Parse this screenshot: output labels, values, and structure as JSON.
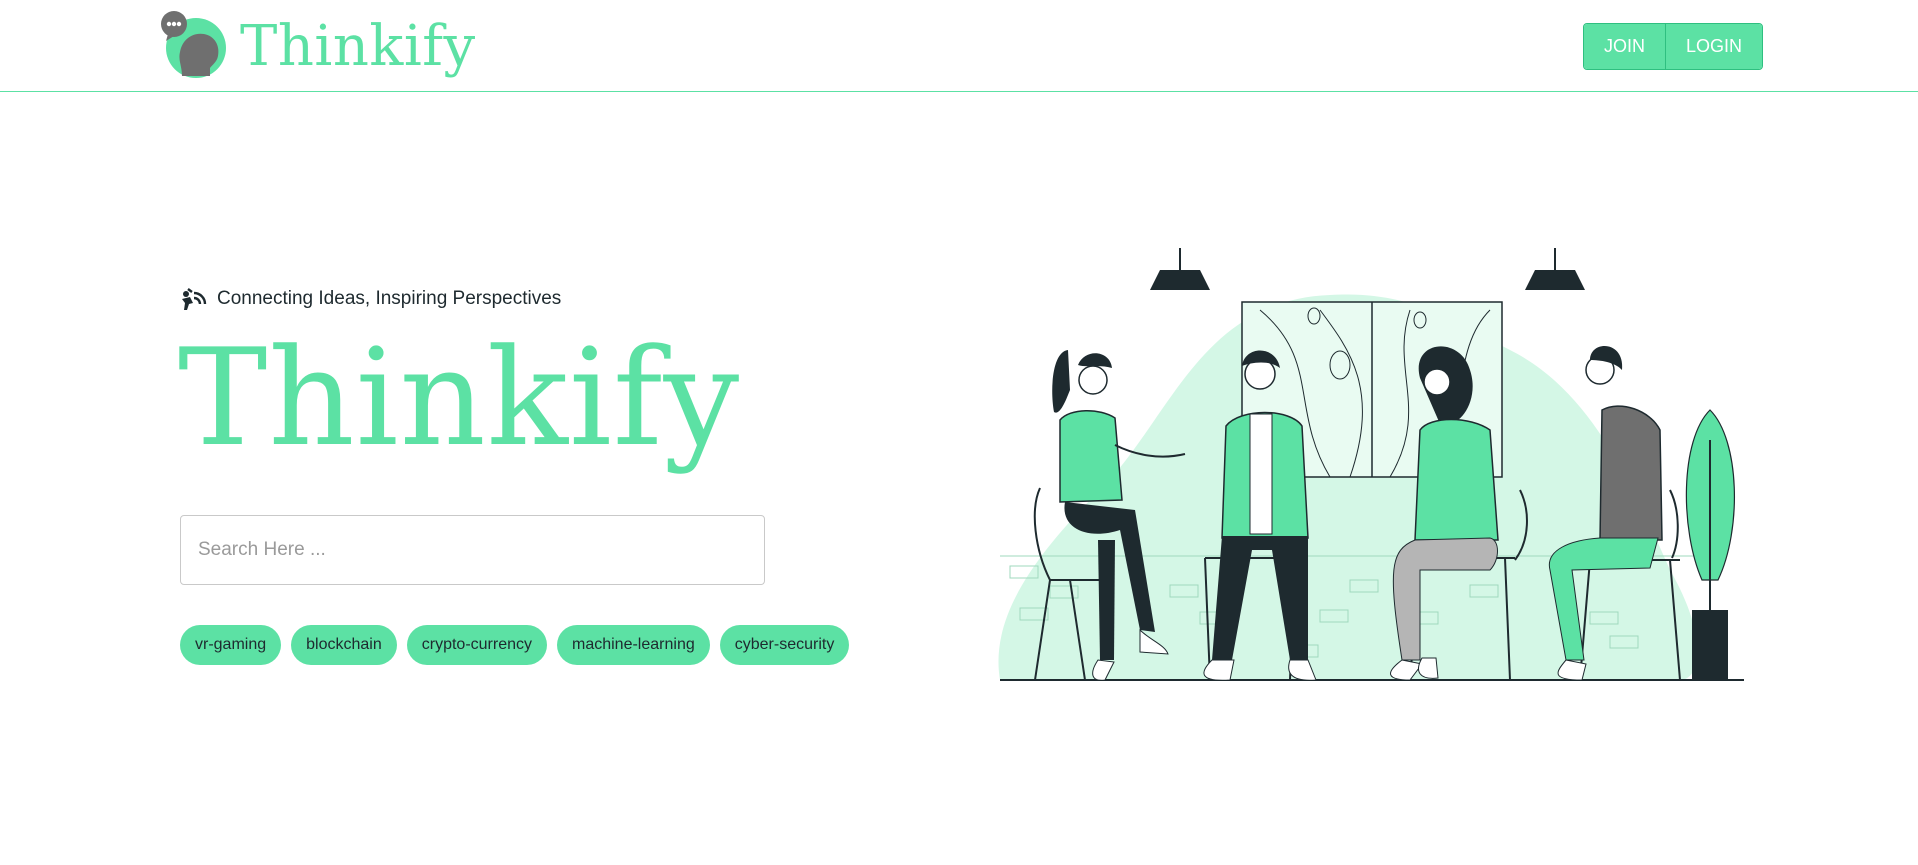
{
  "header": {
    "brand": "Thinkify",
    "logo_icon": "speech-head-logo-icon",
    "join_label": "JOIN",
    "login_label": "LOGIN"
  },
  "hero": {
    "tagline": "Connecting Ideas, Inspiring Perspectives",
    "tagline_icon": "broadcast-icon",
    "title": "Thinkify",
    "search": {
      "placeholder": "Search Here ...",
      "value": ""
    },
    "tags": [
      "vr-gaming",
      "blockchain",
      "crypto-currency",
      "machine-learning",
      "cyber-security"
    ]
  },
  "illustration": {
    "name": "people-discussion-illustration"
  },
  "colors": {
    "accent": "#5ce1a4",
    "dark": "#1e2a2f",
    "grey": "#7a7a7a",
    "light_accent": "#d4f7e6"
  }
}
